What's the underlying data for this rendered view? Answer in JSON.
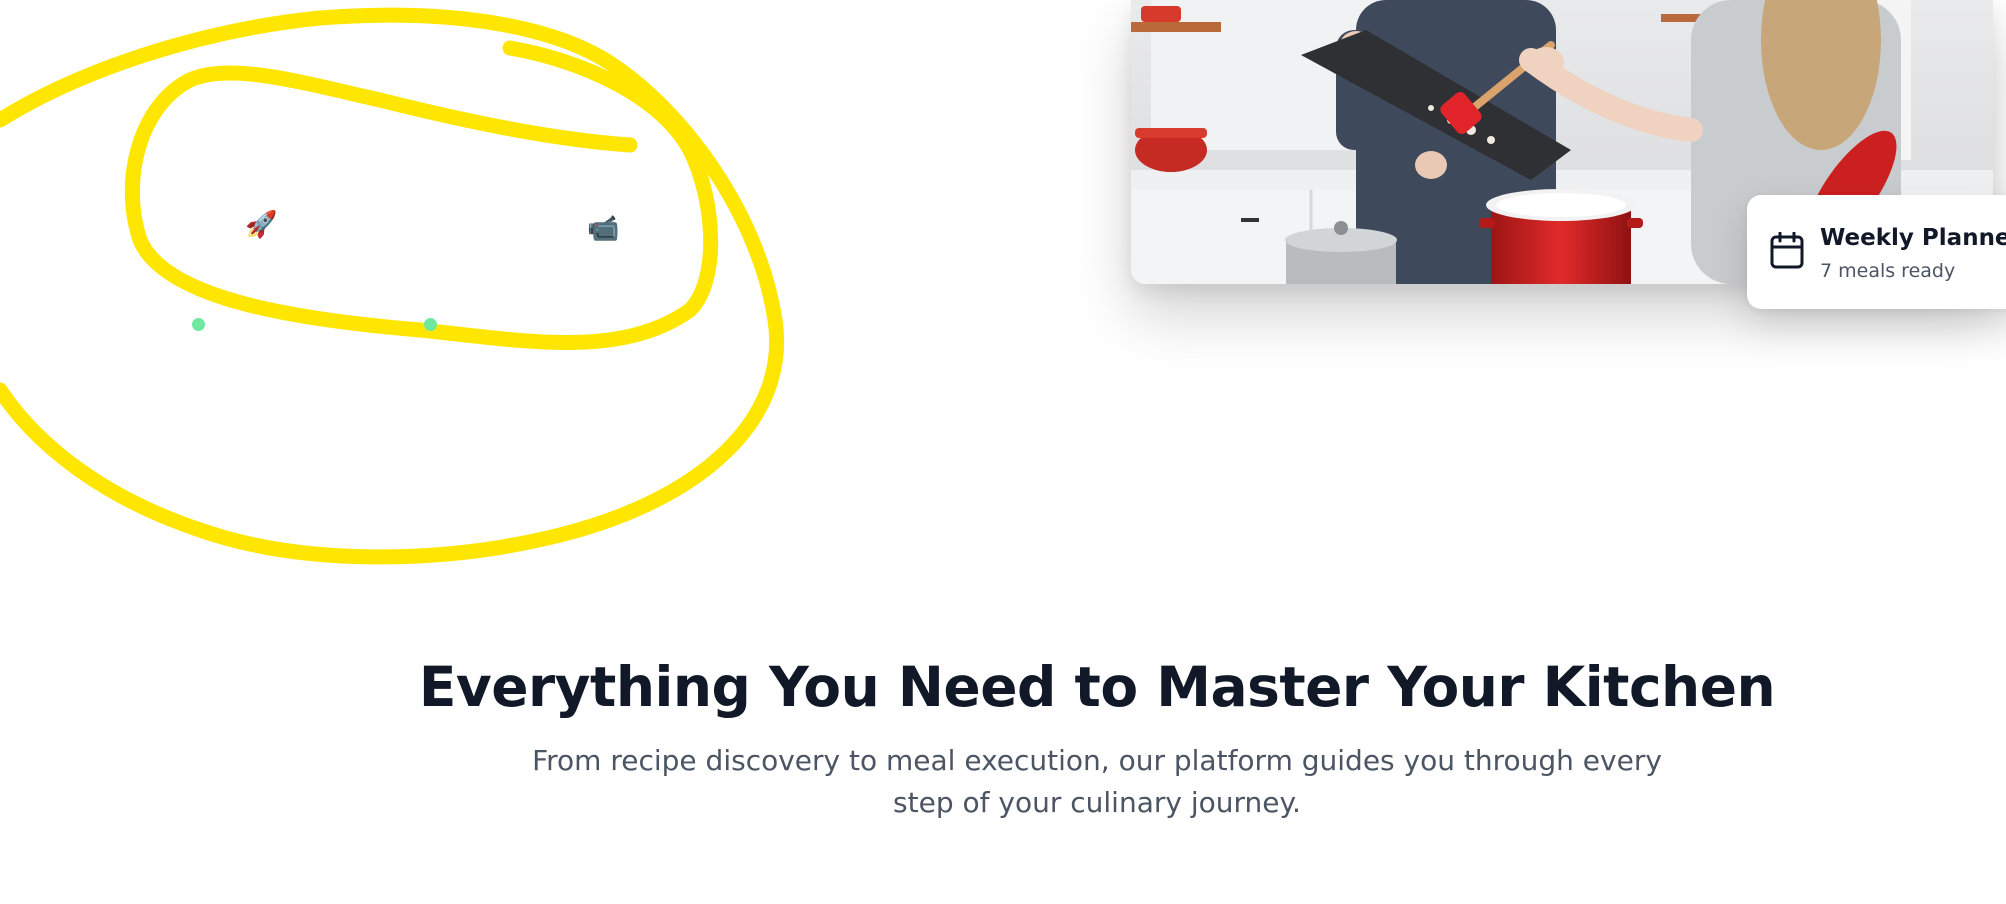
{
  "annotation": {
    "scribble_color": "#FFE600",
    "markers": [
      {
        "icon": "rocket-icon",
        "glyph": "🚀"
      },
      {
        "icon": "video-camera-icon",
        "glyph": "📹"
      }
    ],
    "dot_color": "#6EE7A0"
  },
  "hero": {
    "image": "people-cooking-in-kitchen-photo"
  },
  "plan_card": {
    "icon": "calendar-icon",
    "title": "Weekly Planned",
    "subtitle": "7 meals ready"
  },
  "features": {
    "title": "Everything You Need to Master Your Kitchen",
    "subtitle": "From recipe discovery to meal execution, our platform guides you through every step of your culinary journey."
  },
  "colors": {
    "heading": "#111827",
    "body_text": "#4b5563",
    "accent_red": "#d62828"
  }
}
